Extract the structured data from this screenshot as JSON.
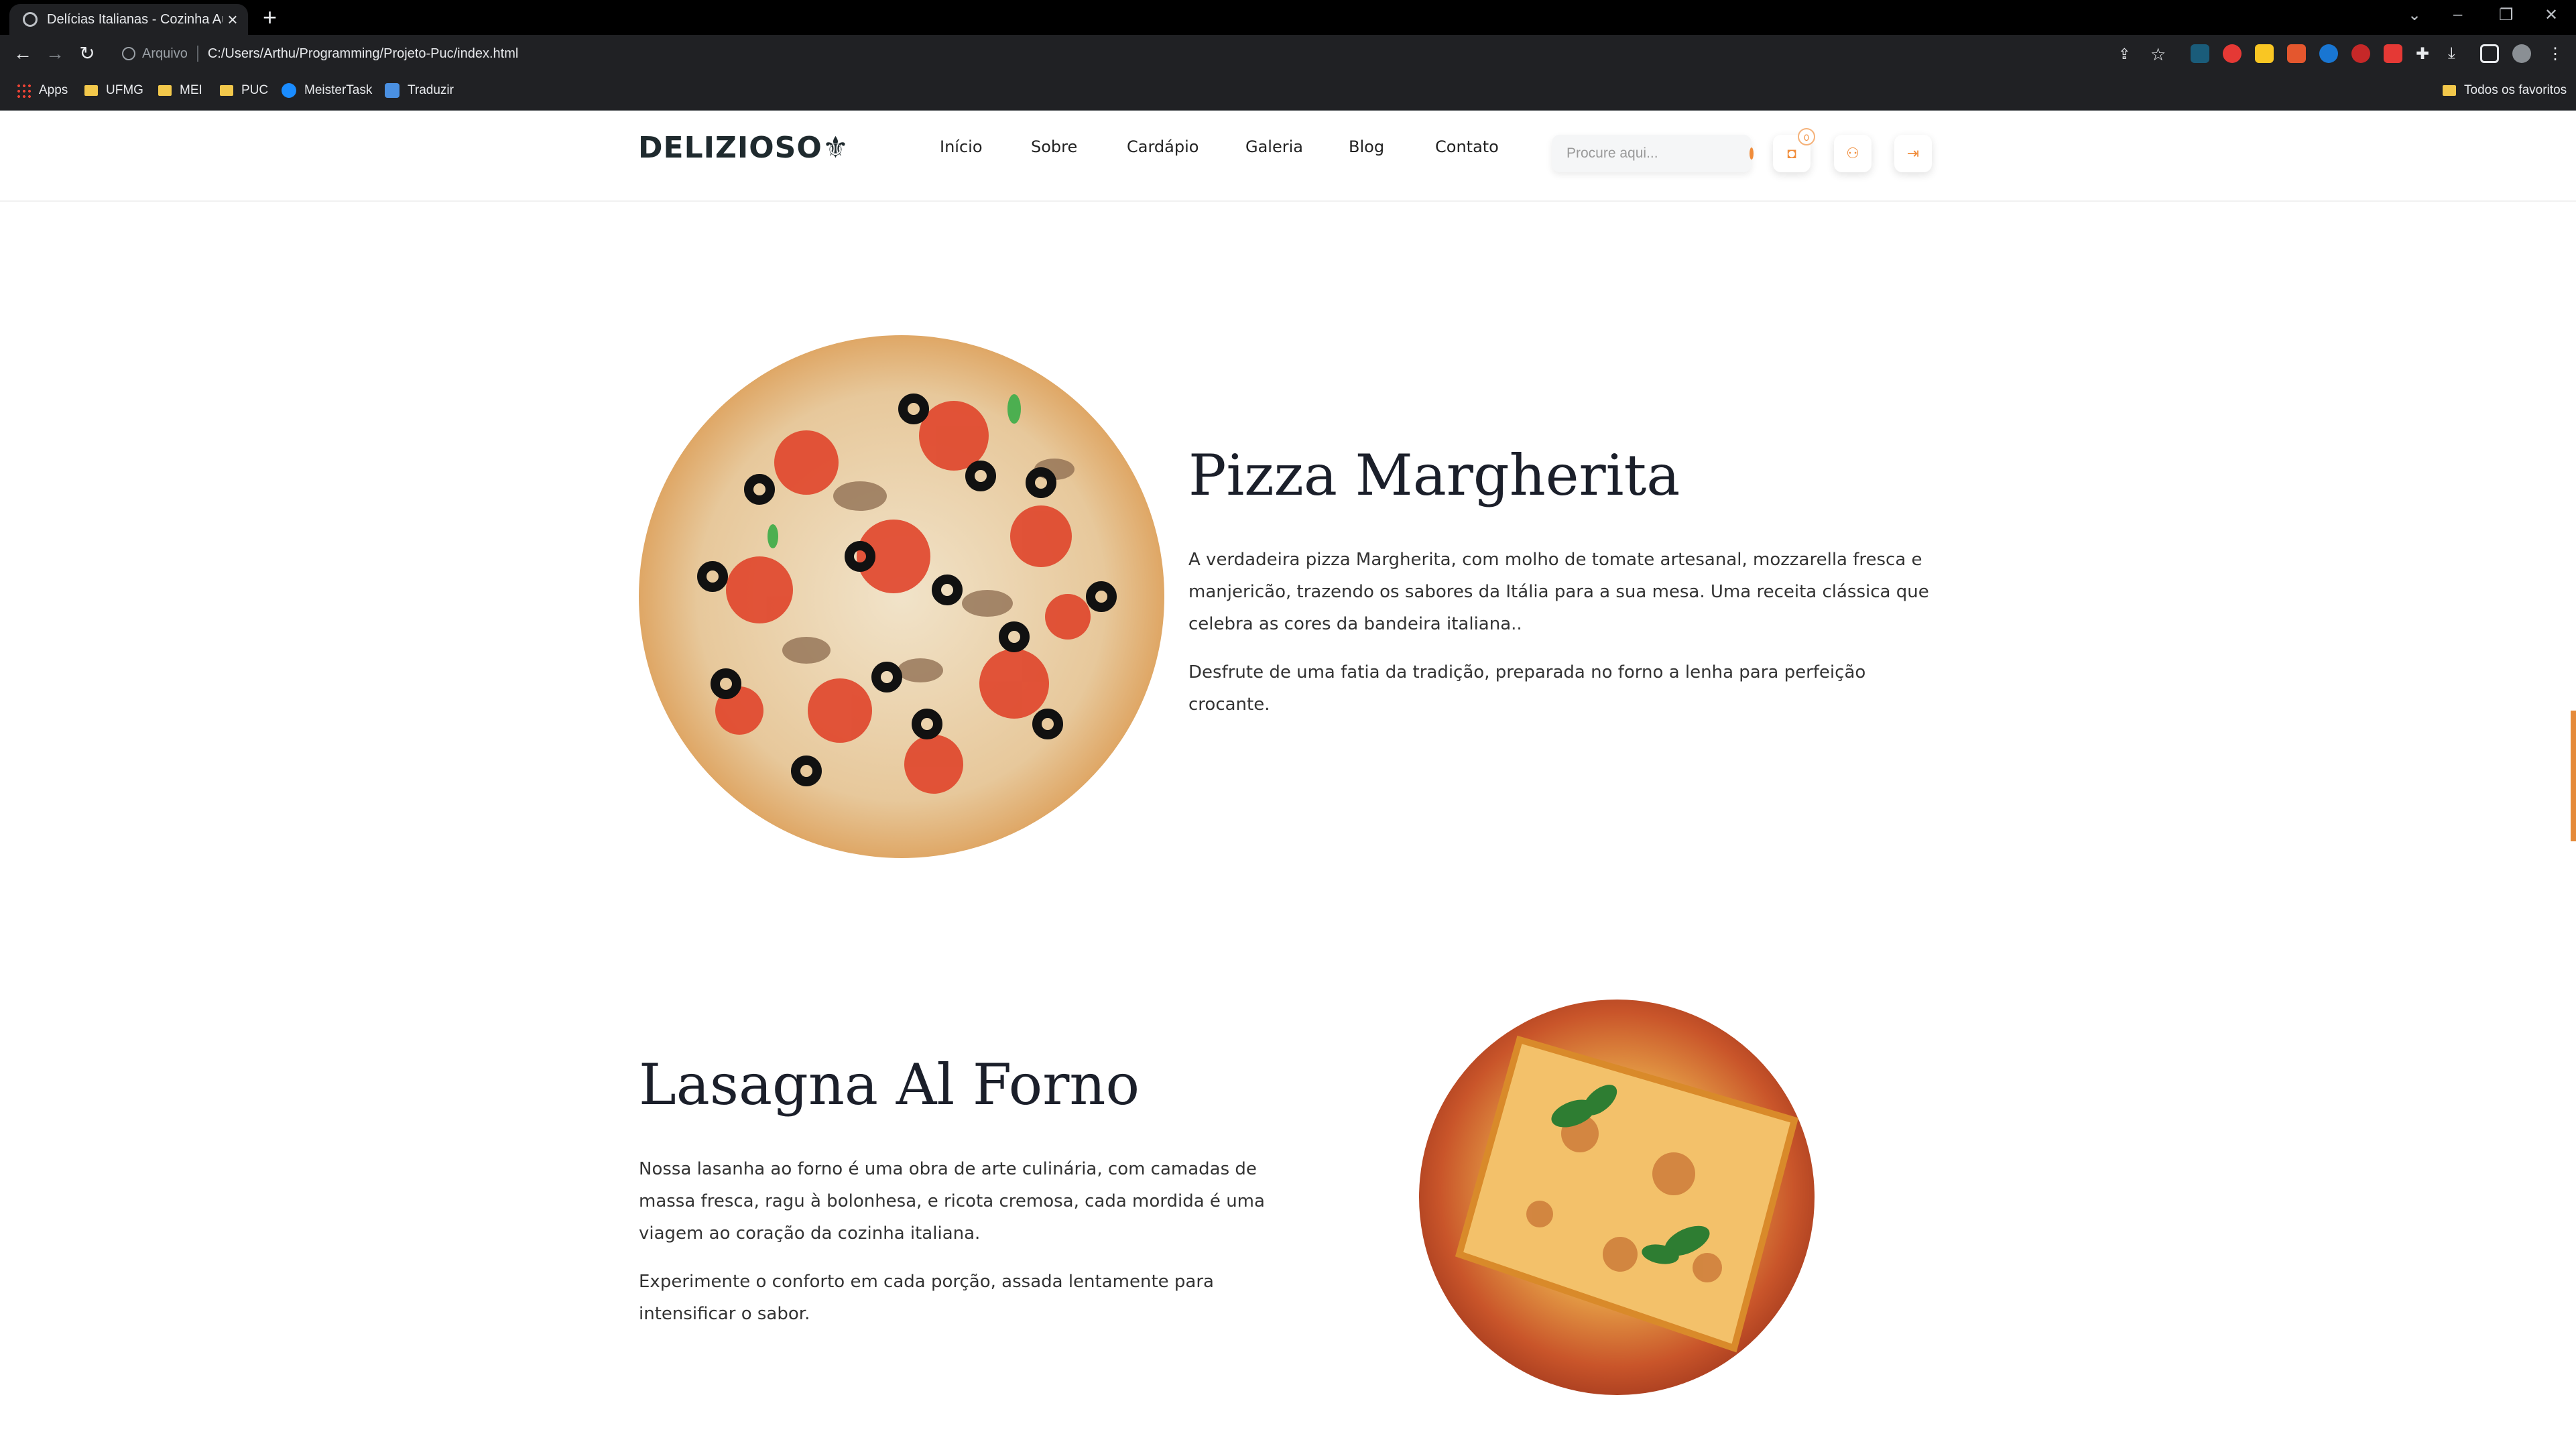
{
  "browser": {
    "tab_title": "Delícias Italianas - Cozinha Autê",
    "new_tab": "+",
    "close": "×",
    "address_scheme": "Arquivo",
    "address_path": "C:/Users/Arthu/Programming/Projeto-Puc/index.html",
    "bookmarks": [
      "Apps",
      "UFMG",
      "MEI",
      "PUC",
      "MeisterTask",
      "Traduzir"
    ],
    "other_bookmarks": "Todos os favoritos"
  },
  "site": {
    "logo": "DELIZIOSO",
    "nav": [
      "Início",
      "Sobre",
      "Cardápio",
      "Galeria",
      "Blog",
      "Contato"
    ],
    "search_placeholder": "Procure aqui...",
    "cart_count": "0"
  },
  "dishes": [
    {
      "title": "Pizza Margherita",
      "paragraphs": [
        "A verdadeira pizza Margherita, com molho de tomate artesanal, mozzarella fresca e manjericão, trazendo os sabores da Itália para a sua mesa. Uma receita clássica que celebra as cores da bandeira italiana..",
        "Desfrute de uma fatia da tradição, preparada no forno a lenha para perfeição crocante."
      ]
    },
    {
      "title": "Lasagna Al Forno",
      "paragraphs": [
        "Nossa lasanha ao forno é uma obra de arte culinária, com camadas de massa fresca, ragu à bolonhesa, e ricota cremosa, cada mordida é uma viagem ao coração da cozinha italiana.",
        "Experimente o conforto em cada porção, assada lentamente para intensificar o sabor."
      ]
    }
  ],
  "colors": {
    "accent": "#f08c3a",
    "text_dark": "#1b1f2a"
  },
  "icons": {
    "search": "search-icon",
    "cart": "shopping-bag-icon",
    "user": "user-icon",
    "login": "login-icon"
  }
}
